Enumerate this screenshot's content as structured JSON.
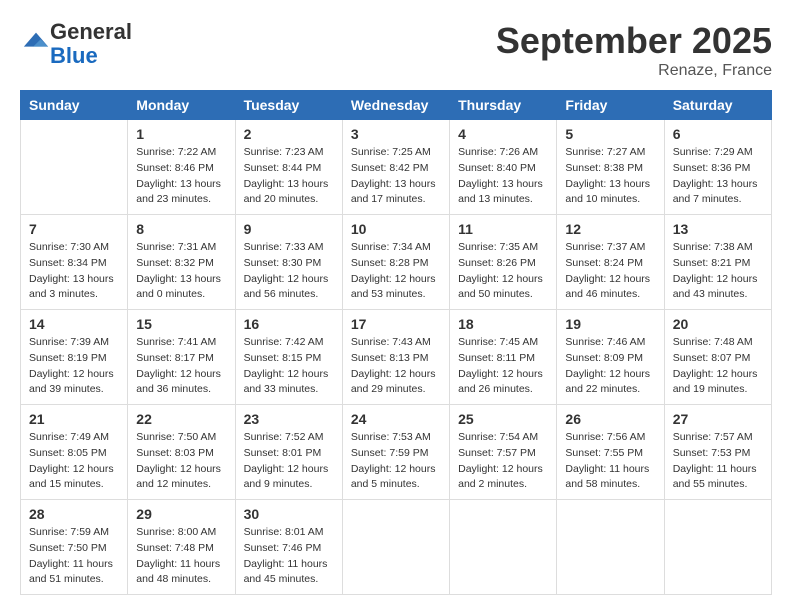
{
  "logo": {
    "general": "General",
    "blue": "Blue"
  },
  "header": {
    "month": "September 2025",
    "location": "Renaze, France"
  },
  "weekdays": [
    "Sunday",
    "Monday",
    "Tuesday",
    "Wednesday",
    "Thursday",
    "Friday",
    "Saturday"
  ],
  "weeks": [
    [
      {
        "day": null,
        "info": null
      },
      {
        "day": "1",
        "info": "Sunrise: 7:22 AM\nSunset: 8:46 PM\nDaylight: 13 hours\nand 23 minutes."
      },
      {
        "day": "2",
        "info": "Sunrise: 7:23 AM\nSunset: 8:44 PM\nDaylight: 13 hours\nand 20 minutes."
      },
      {
        "day": "3",
        "info": "Sunrise: 7:25 AM\nSunset: 8:42 PM\nDaylight: 13 hours\nand 17 minutes."
      },
      {
        "day": "4",
        "info": "Sunrise: 7:26 AM\nSunset: 8:40 PM\nDaylight: 13 hours\nand 13 minutes."
      },
      {
        "day": "5",
        "info": "Sunrise: 7:27 AM\nSunset: 8:38 PM\nDaylight: 13 hours\nand 10 minutes."
      },
      {
        "day": "6",
        "info": "Sunrise: 7:29 AM\nSunset: 8:36 PM\nDaylight: 13 hours\nand 7 minutes."
      }
    ],
    [
      {
        "day": "7",
        "info": "Sunrise: 7:30 AM\nSunset: 8:34 PM\nDaylight: 13 hours\nand 3 minutes."
      },
      {
        "day": "8",
        "info": "Sunrise: 7:31 AM\nSunset: 8:32 PM\nDaylight: 13 hours\nand 0 minutes."
      },
      {
        "day": "9",
        "info": "Sunrise: 7:33 AM\nSunset: 8:30 PM\nDaylight: 12 hours\nand 56 minutes."
      },
      {
        "day": "10",
        "info": "Sunrise: 7:34 AM\nSunset: 8:28 PM\nDaylight: 12 hours\nand 53 minutes."
      },
      {
        "day": "11",
        "info": "Sunrise: 7:35 AM\nSunset: 8:26 PM\nDaylight: 12 hours\nand 50 minutes."
      },
      {
        "day": "12",
        "info": "Sunrise: 7:37 AM\nSunset: 8:24 PM\nDaylight: 12 hours\nand 46 minutes."
      },
      {
        "day": "13",
        "info": "Sunrise: 7:38 AM\nSunset: 8:21 PM\nDaylight: 12 hours\nand 43 minutes."
      }
    ],
    [
      {
        "day": "14",
        "info": "Sunrise: 7:39 AM\nSunset: 8:19 PM\nDaylight: 12 hours\nand 39 minutes."
      },
      {
        "day": "15",
        "info": "Sunrise: 7:41 AM\nSunset: 8:17 PM\nDaylight: 12 hours\nand 36 minutes."
      },
      {
        "day": "16",
        "info": "Sunrise: 7:42 AM\nSunset: 8:15 PM\nDaylight: 12 hours\nand 33 minutes."
      },
      {
        "day": "17",
        "info": "Sunrise: 7:43 AM\nSunset: 8:13 PM\nDaylight: 12 hours\nand 29 minutes."
      },
      {
        "day": "18",
        "info": "Sunrise: 7:45 AM\nSunset: 8:11 PM\nDaylight: 12 hours\nand 26 minutes."
      },
      {
        "day": "19",
        "info": "Sunrise: 7:46 AM\nSunset: 8:09 PM\nDaylight: 12 hours\nand 22 minutes."
      },
      {
        "day": "20",
        "info": "Sunrise: 7:48 AM\nSunset: 8:07 PM\nDaylight: 12 hours\nand 19 minutes."
      }
    ],
    [
      {
        "day": "21",
        "info": "Sunrise: 7:49 AM\nSunset: 8:05 PM\nDaylight: 12 hours\nand 15 minutes."
      },
      {
        "day": "22",
        "info": "Sunrise: 7:50 AM\nSunset: 8:03 PM\nDaylight: 12 hours\nand 12 minutes."
      },
      {
        "day": "23",
        "info": "Sunrise: 7:52 AM\nSunset: 8:01 PM\nDaylight: 12 hours\nand 9 minutes."
      },
      {
        "day": "24",
        "info": "Sunrise: 7:53 AM\nSunset: 7:59 PM\nDaylight: 12 hours\nand 5 minutes."
      },
      {
        "day": "25",
        "info": "Sunrise: 7:54 AM\nSunset: 7:57 PM\nDaylight: 12 hours\nand 2 minutes."
      },
      {
        "day": "26",
        "info": "Sunrise: 7:56 AM\nSunset: 7:55 PM\nDaylight: 11 hours\nand 58 minutes."
      },
      {
        "day": "27",
        "info": "Sunrise: 7:57 AM\nSunset: 7:53 PM\nDaylight: 11 hours\nand 55 minutes."
      }
    ],
    [
      {
        "day": "28",
        "info": "Sunrise: 7:59 AM\nSunset: 7:50 PM\nDaylight: 11 hours\nand 51 minutes."
      },
      {
        "day": "29",
        "info": "Sunrise: 8:00 AM\nSunset: 7:48 PM\nDaylight: 11 hours\nand 48 minutes."
      },
      {
        "day": "30",
        "info": "Sunrise: 8:01 AM\nSunset: 7:46 PM\nDaylight: 11 hours\nand 45 minutes."
      },
      {
        "day": null,
        "info": null
      },
      {
        "day": null,
        "info": null
      },
      {
        "day": null,
        "info": null
      },
      {
        "day": null,
        "info": null
      }
    ]
  ]
}
